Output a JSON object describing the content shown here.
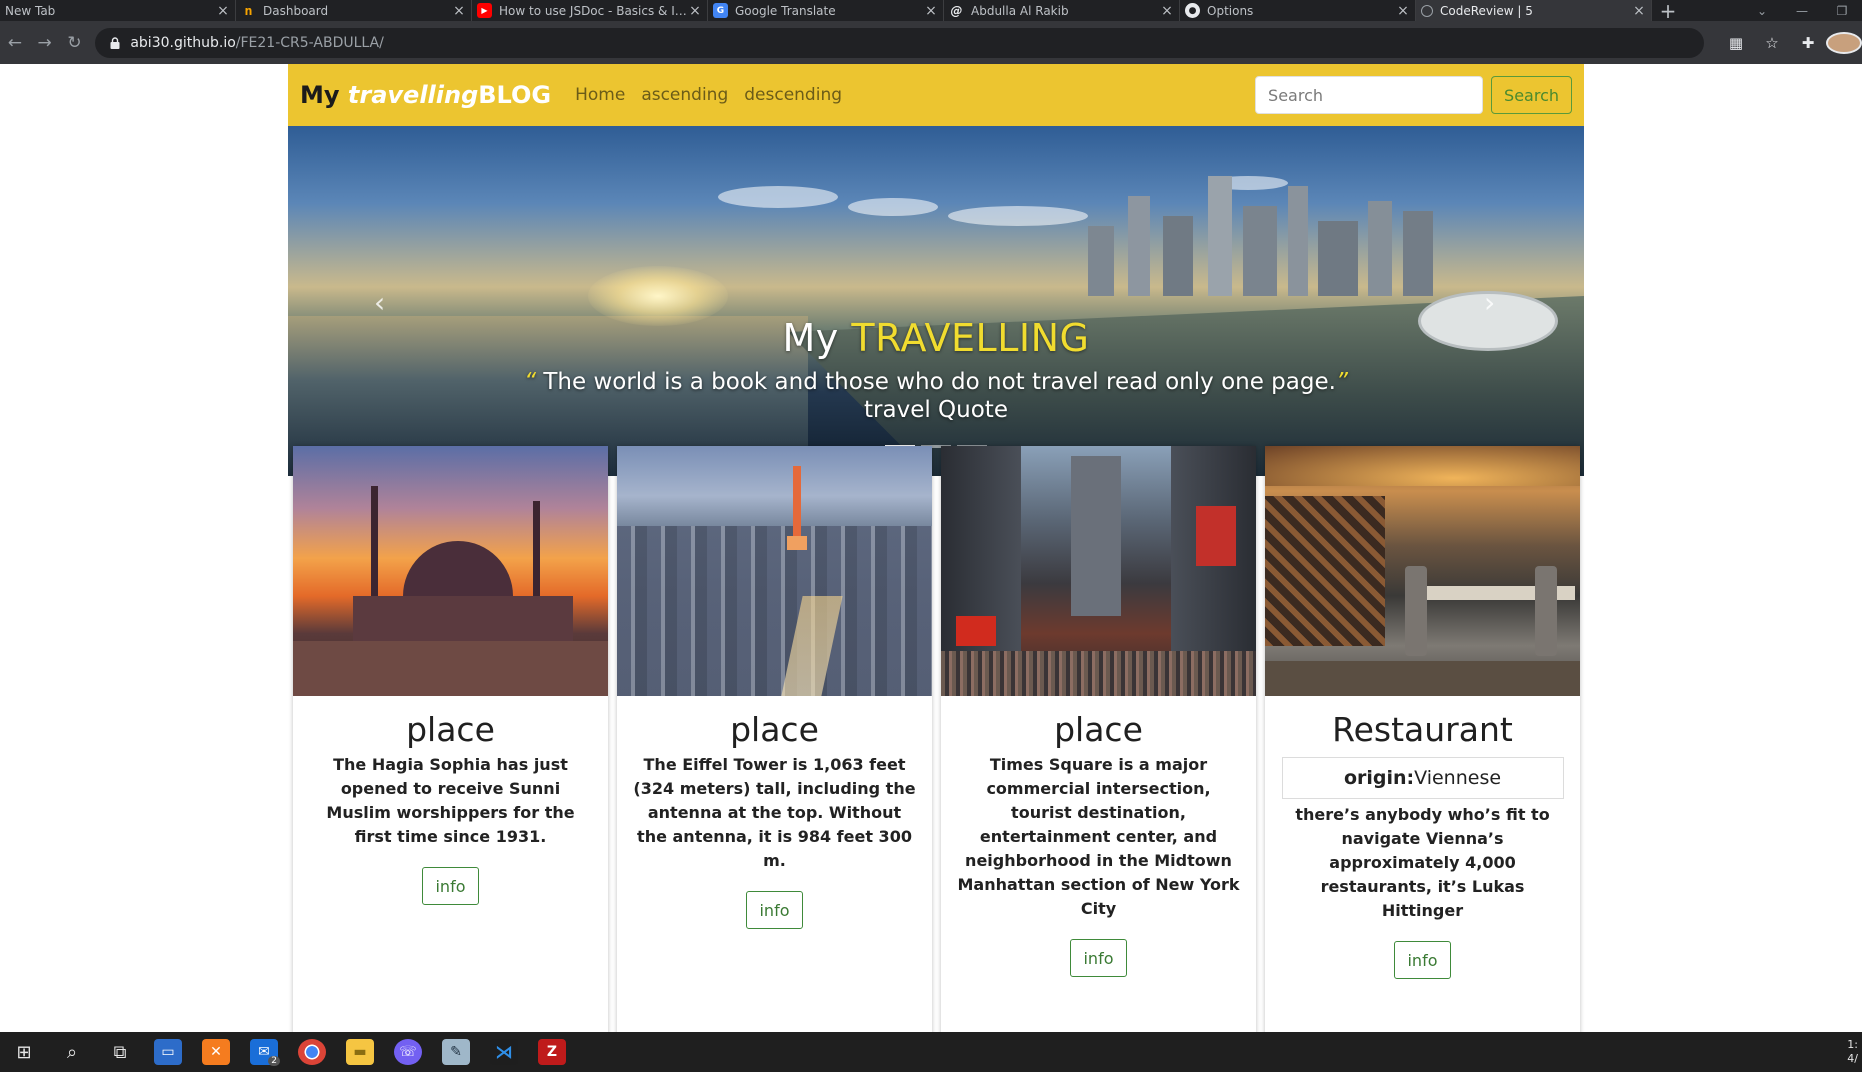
{
  "browser": {
    "tabs": [
      {
        "title": "New Tab",
        "icon": "new-tab-icon",
        "color": "#202124"
      },
      {
        "title": "Dashboard",
        "icon": "dashboard-favicon",
        "color": "#f7a400"
      },
      {
        "title": "How to use JSDoc - Basics & Intr",
        "icon": "youtube-favicon",
        "color": "#ff0000"
      },
      {
        "title": "Google Translate",
        "icon": "google-translate-favicon",
        "color": "#4285f4"
      },
      {
        "title": "Abdulla Al Rakib",
        "icon": "profile-favicon",
        "color": "#bdc1c6"
      },
      {
        "title": "Options",
        "icon": "github-favicon",
        "color": "#e8eaed"
      },
      {
        "title": "CodeReview | 5",
        "icon": "page-favicon",
        "color": "#9aa0a6"
      }
    ],
    "active_tab_index": 6,
    "new_tab_label": "+",
    "url_host": "abi30.github.io",
    "url_path": "/FE21-CR5-ABDULLA/"
  },
  "navbar": {
    "brand_prefix": "My",
    "brand_italic": "travelling",
    "brand_suffix": "BLOG",
    "links": [
      "Home",
      "ascending",
      "descending"
    ],
    "search_placeholder": "Search",
    "search_button": "Search"
  },
  "hero": {
    "title_prefix": "My",
    "title_highlight": "TRAVELLING",
    "quote_open": "“",
    "quote": "The world is a book and those who do not travel read only one page.",
    "quote_close": "”",
    "quote_author": "travel Quote",
    "slides_count": 3,
    "active_slide": 0,
    "highlight_color": "#f1dc2f"
  },
  "cards": [
    {
      "image": "hagia-sophia-image",
      "title": "place",
      "text": "The Hagia Sophia has just opened to receive Sunni Muslim worshippers for the first time since 1931.",
      "button": "info"
    },
    {
      "image": "tokyo-tower-image",
      "title": "place",
      "text": "The Eiffel Tower is 1,063 feet (324 meters) tall, including the antenna at the top. Without the antenna, it is 984 feet 300 m.",
      "button": "info"
    },
    {
      "image": "times-square-image",
      "title": "place",
      "text": "Times Square is a major commercial intersection, tourist destination, entertainment center, and neighborhood in the Midtown Manhattan section of New York City",
      "button": "info"
    },
    {
      "image": "restaurant-image",
      "title": "Restaurant",
      "origin_label": "origin:",
      "origin_value": "Viennese",
      "text": "there’s anybody who’s fit to navigate Vienna’s approximately 4,000 restaurants, it’s Lukas Hittinger",
      "button": "info"
    }
  ],
  "colors": {
    "navbar_bg": "#ecc530",
    "button_green": "#3a7a33"
  },
  "taskbar": {
    "apps": [
      "windows-start-icon",
      "search-icon",
      "task-view-icon",
      "explorer-icon",
      "xampp-icon",
      "mail-icon",
      "chrome-icon",
      "folder-icon",
      "viber-icon",
      "notes-icon",
      "vscode-icon",
      "filezilla-icon"
    ],
    "mail_badge": "2",
    "clock_time": "1:",
    "clock_date": "4/"
  }
}
